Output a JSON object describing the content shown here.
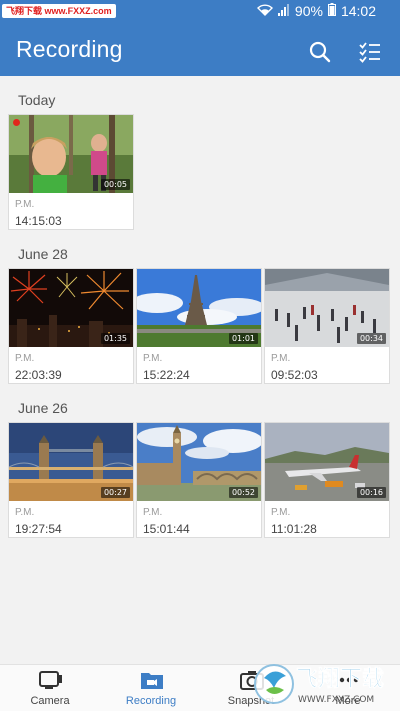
{
  "status_bar": {
    "site_tag": "飞翔下载 www.FXXZ.com",
    "battery": "90%",
    "time": "14:02"
  },
  "app_bar": {
    "title": "Recording",
    "search_icon": "search-icon",
    "select_icon": "checklist-icon"
  },
  "sections": [
    {
      "header": "Today",
      "items": [
        {
          "thumb": "kids-in-forest",
          "duration": "00:05",
          "period": "P.M.",
          "time": "14:15:03",
          "recording": true
        }
      ]
    },
    {
      "header": "June 28",
      "items": [
        {
          "thumb": "fireworks",
          "duration": "01:35",
          "period": "P.M.",
          "time": "22:03:39"
        },
        {
          "thumb": "eiffel-tower",
          "duration": "01:01",
          "period": "P.M.",
          "time": "15:22:24"
        },
        {
          "thumb": "station-crowd",
          "duration": "00:34",
          "period": "P.M.",
          "time": "09:52:03"
        }
      ]
    },
    {
      "header": "June 26",
      "items": [
        {
          "thumb": "tower-bridge",
          "duration": "00:27",
          "period": "P.M.",
          "time": "19:27:54"
        },
        {
          "thumb": "big-ben",
          "duration": "00:52",
          "period": "P.M.",
          "time": "15:01:44"
        },
        {
          "thumb": "airport",
          "duration": "00:16",
          "period": "P.M.",
          "time": "11:01:28"
        }
      ]
    }
  ],
  "bottom_nav": [
    {
      "label": "Camera",
      "icon": "camera-icon",
      "active": false
    },
    {
      "label": "Recording",
      "icon": "recording-folder-icon",
      "active": true
    },
    {
      "label": "Snapshot",
      "icon": "snapshot-icon",
      "active": false
    },
    {
      "label": "More",
      "icon": "more-icon",
      "active": false
    }
  ],
  "watermark": {
    "text": "飞翔下载",
    "url": "WWW.FXXZ.COM"
  },
  "colors": {
    "primary": "#3d7dc5",
    "background": "#f2f2f2",
    "record_dot": "#e0261c"
  }
}
